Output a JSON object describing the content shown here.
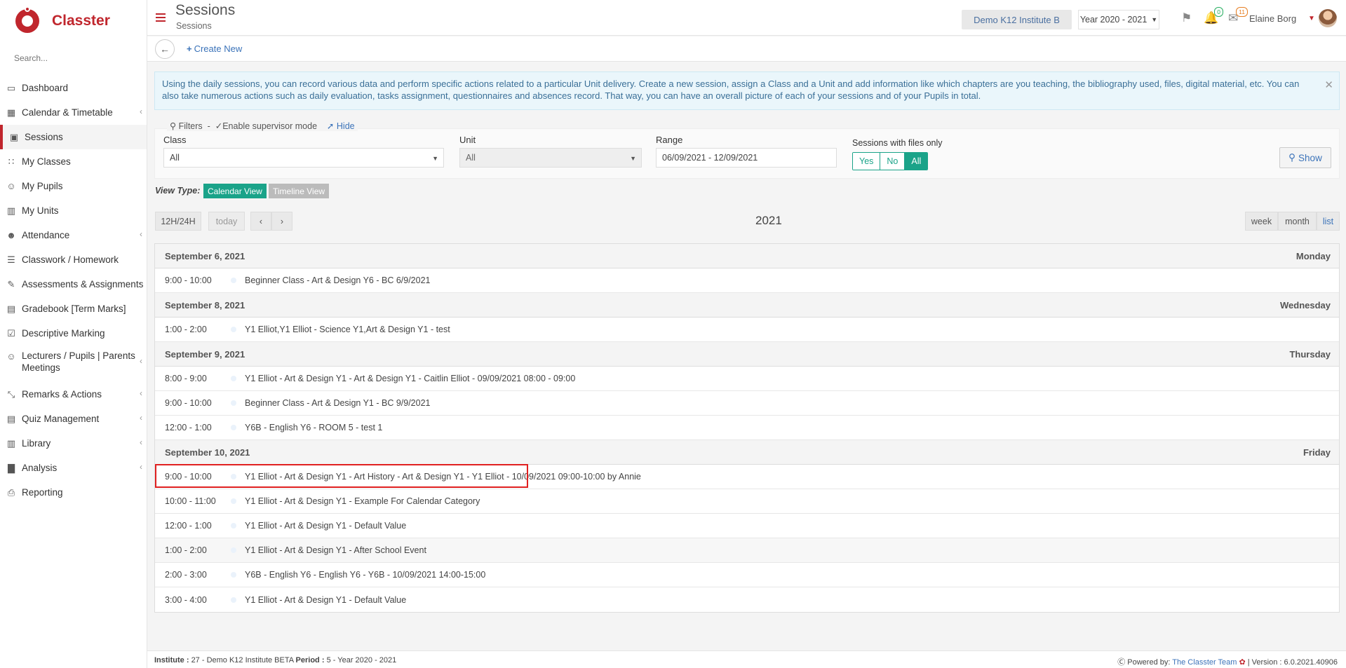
{
  "app": {
    "brand": "Classter"
  },
  "sidebar": {
    "search_placeholder": "Search...",
    "items": [
      {
        "label": "Dashboard",
        "icon": "monitor-icon",
        "glyph": "▭",
        "chevron": false
      },
      {
        "label": "Calendar & Timetable",
        "icon": "calendar-icon",
        "glyph": "▦",
        "chevron": true
      },
      {
        "label": "Sessions",
        "icon": "sessions-icon",
        "glyph": "▣",
        "chevron": false,
        "active": true
      },
      {
        "label": "My Classes",
        "icon": "classes-icon",
        "glyph": "∷",
        "chevron": false
      },
      {
        "label": "My Pupils",
        "icon": "pupils-icon",
        "glyph": "☺",
        "chevron": false
      },
      {
        "label": "My Units",
        "icon": "book-icon",
        "glyph": "▥",
        "chevron": false
      },
      {
        "label": "Attendance",
        "icon": "attendance-icon",
        "glyph": "☻",
        "chevron": true
      },
      {
        "label": "Classwork / Homework",
        "icon": "list-icon",
        "glyph": "☰",
        "chevron": false
      },
      {
        "label": "Assessments & Assignments",
        "icon": "edit-icon",
        "glyph": "✎",
        "chevron": true
      },
      {
        "label": "Gradebook [Term Marks]",
        "icon": "gradebook-icon",
        "glyph": "▤",
        "chevron": false
      },
      {
        "label": "Descriptive Marking",
        "icon": "marking-icon",
        "glyph": "☑",
        "chevron": false
      },
      {
        "label": "Lecturers / Pupils | Parents Meetings",
        "icon": "meetings-icon",
        "glyph": "☺",
        "chevron": true,
        "tall": true
      },
      {
        "label": "Remarks & Actions",
        "icon": "remarks-icon",
        "glyph": "⤡",
        "chevron": true
      },
      {
        "label": "Quiz Management",
        "icon": "quiz-icon",
        "glyph": "▤",
        "chevron": true
      },
      {
        "label": "Library",
        "icon": "library-icon",
        "glyph": "▥",
        "chevron": true
      },
      {
        "label": "Analysis",
        "icon": "analysis-icon",
        "glyph": "▇",
        "chevron": true
      },
      {
        "label": "Reporting",
        "icon": "printer-icon",
        "glyph": "⎙",
        "chevron": false
      }
    ]
  },
  "header": {
    "title": "Sessions",
    "subtitle": "Sessions",
    "institute": "Demo K12 Institute B",
    "year": "Year 2020 - 2021",
    "notifications_count": "0",
    "messages_count": "11",
    "user_name": "Elaine Borg"
  },
  "toolbar": {
    "create_new": "Create New"
  },
  "info": {
    "text": "Using the daily sessions, you can record various data and perform specific actions related to a particular Unit delivery. Create a new session, assign a Class and a Unit and add information like which chapters are you teaching, the bibliography used, files, digital material, etc. You can also take numerous actions such as daily evaluation, tasks assignment, questionnaires and absences record. That way, you can have an overall picture of each of your sessions and of your Pupils in total."
  },
  "filters": {
    "filters_label": "Filters",
    "supervisor_label": "Enable supervisor mode",
    "hide_label": "Hide",
    "class_label": "Class",
    "class_value": "All",
    "unit_label": "Unit",
    "unit_value": "All",
    "range_label": "Range",
    "range_value": "06/09/2021 - 12/09/2021",
    "files_label": "Sessions with files only",
    "files_options": [
      "Yes",
      "No",
      "All"
    ],
    "files_selected": "All",
    "show_label": "Show"
  },
  "view_type": {
    "label": "View Type:",
    "calendar": "Calendar View",
    "timeline": "Timeline View"
  },
  "calendar": {
    "btn_1224": "12H/24H",
    "btn_today": "today",
    "title": "2021",
    "views": [
      "week",
      "month",
      "list"
    ],
    "active_view": "list"
  },
  "days": [
    {
      "date": "September 6, 2021",
      "weekday": "Monday",
      "events": [
        {
          "time": "9:00 - 10:00",
          "title": "Beginner Class - Art & Design Y6 - BC 6/9/2021"
        }
      ]
    },
    {
      "date": "September 8, 2021",
      "weekday": "Wednesday",
      "events": [
        {
          "time": "1:00 - 2:00",
          "title": "Y1 Elliot,Y1 Elliot - Science Y1,Art & Design Y1 - test"
        }
      ]
    },
    {
      "date": "September 9, 2021",
      "weekday": "Thursday",
      "events": [
        {
          "time": "8:00 - 9:00",
          "title": "Y1 Elliot - Art & Design Y1 - Art & Design Y1 - Caitlin Elliot - 09/09/2021 08:00 - 09:00"
        },
        {
          "time": "9:00 - 10:00",
          "title": "Beginner Class - Art & Design Y1 - BC 9/9/2021"
        },
        {
          "time": "12:00 - 1:00",
          "title": "Y6B - English Y6 - ROOM 5 - test 1"
        }
      ]
    },
    {
      "date": "September 10, 2021",
      "weekday": "Friday",
      "events": [
        {
          "time": "9:00 - 10:00",
          "title": "Y1 Elliot - Art & Design Y1 - Art History - Art & Design Y1 - Y1 Elliot - 10/09/2021 09:00-10:00 by Annie"
        },
        {
          "time": "10:00 - 11:00",
          "title": "Y1 Elliot - Art & Design Y1 - Example For Calendar Category"
        },
        {
          "time": "12:00 - 1:00",
          "title": "Y1 Elliot - Art & Design Y1 - Default Value"
        },
        {
          "time": "1:00 - 2:00",
          "title": "Y1 Elliot - Art & Design Y1 - After School Event",
          "hover": true
        },
        {
          "time": "2:00 - 3:00",
          "title": "Y6B - English Y6 - English Y6 - Y6B - 10/09/2021 14:00-15:00"
        },
        {
          "time": "3:00 - 4:00",
          "title": "Y1 Elliot - Art & Design Y1 - Default Value"
        }
      ]
    }
  ],
  "footer": {
    "institute_label": "Institute :",
    "institute_value": "27 - Demo K12 Institute BETA",
    "period_label": "Period :",
    "period_value": "5 - Year 2020 - 2021",
    "powered_by": "Powered by:",
    "team": "The Classter Team",
    "version": "| Version : 6.0.2021.40906"
  }
}
